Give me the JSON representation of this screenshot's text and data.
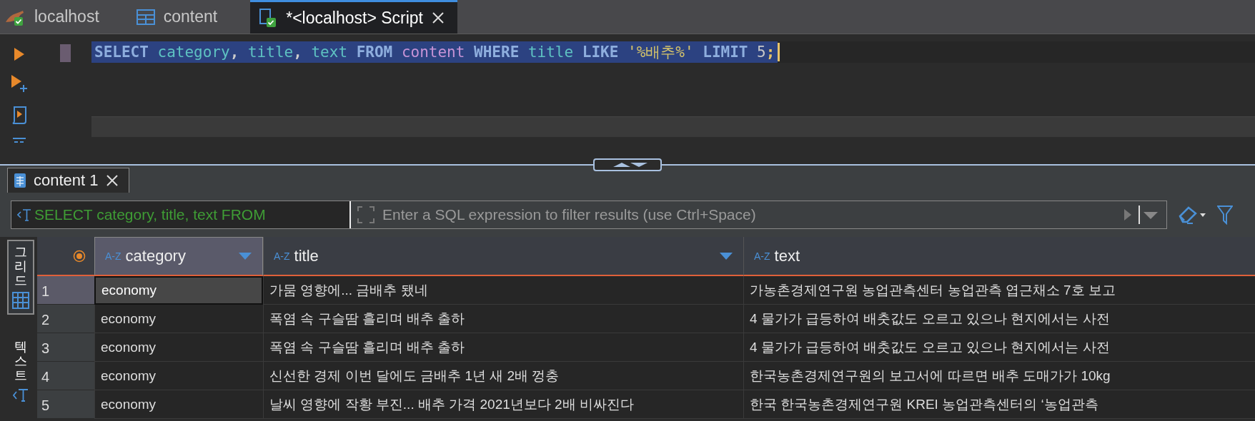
{
  "editor_tabs": [
    {
      "kind": "connection",
      "label": "localhost",
      "selected": false,
      "closable": false
    },
    {
      "kind": "table",
      "label": "content",
      "selected": false,
      "closable": false
    },
    {
      "kind": "script",
      "label": "*<localhost> Script",
      "selected": true,
      "closable": true
    }
  ],
  "editor": {
    "lines": [
      {
        "selected": true,
        "tokens": [
          {
            "kind": "keyword",
            "text": "SELECT"
          },
          {
            "kind": "column",
            "text": " category"
          },
          {
            "kind": "plain",
            "text": ", "
          },
          {
            "kind": "column",
            "text": "title"
          },
          {
            "kind": "plain",
            "text": ", "
          },
          {
            "kind": "column",
            "text": "text"
          },
          {
            "kind": "keyword",
            "text": " FROM "
          },
          {
            "kind": "table",
            "text": "content"
          },
          {
            "kind": "keyword",
            "text": " WHERE "
          },
          {
            "kind": "column",
            "text": "title"
          },
          {
            "kind": "keyword",
            "text": " LIKE "
          },
          {
            "kind": "string",
            "text": "'%배추%'"
          },
          {
            "kind": "keyword",
            "text": " LIMIT "
          },
          {
            "kind": "number",
            "text": "5"
          },
          {
            "kind": "punct",
            "text": ";"
          }
        ]
      }
    ]
  },
  "results": {
    "tabs": [
      {
        "label": "content 1",
        "selected": true
      }
    ],
    "filter": {
      "query": "SELECT category, title, text FROM",
      "placeholder": "Enter a SQL expression to filter results (use Ctrl+Space)"
    },
    "view_tabs": [
      {
        "kind": "grid",
        "label": "그리드",
        "selected": true
      },
      {
        "kind": "text",
        "label": "텍스트",
        "selected": false
      }
    ],
    "columns": [
      {
        "type_label": "A-Z",
        "name": "category",
        "selected": true,
        "menu_arrow": true
      },
      {
        "type_label": "A-Z",
        "name": "title",
        "selected": false,
        "menu_arrow": true
      },
      {
        "type_label": "A-Z",
        "name": "text",
        "selected": false,
        "menu_arrow": false
      }
    ],
    "rows": [
      {
        "number": "1",
        "selected": true,
        "cells": [
          "economy",
          "가뭄 영향에... 금배추 됐네",
          "가농촌경제연구원 농업관측센터 농업관측 엽근채소 7호 보고"
        ]
      },
      {
        "number": "2",
        "selected": false,
        "cells": [
          "economy",
          "폭염 속 구슬땀 흘리며 배추 출하",
          "4 물가가 급등하여 배춧값도 오르고 있으나 현지에서는 사전"
        ]
      },
      {
        "number": "3",
        "selected": false,
        "cells": [
          "economy",
          "폭염 속 구슬땀 흘리며 배추 출하",
          "4 물가가 급등하여 배춧값도 오르고 있으나 현지에서는 사전"
        ]
      },
      {
        "number": "4",
        "selected": false,
        "cells": [
          "economy",
          "신선한 경제 이번 달에도 금배추 1년 새 2배 껑충",
          "한국농촌경제연구원의 보고서에 따르면 배추 도매가가 10kg"
        ]
      },
      {
        "number": "5",
        "selected": false,
        "cells": [
          "economy",
          "날씨 영향에 작황 부진... 배추 가격 2021년보다 2배 비싸진다",
          "한국 한국농촌경제연구원 KREI 농업관측센터의 ‘농업관측"
        ]
      }
    ]
  }
}
